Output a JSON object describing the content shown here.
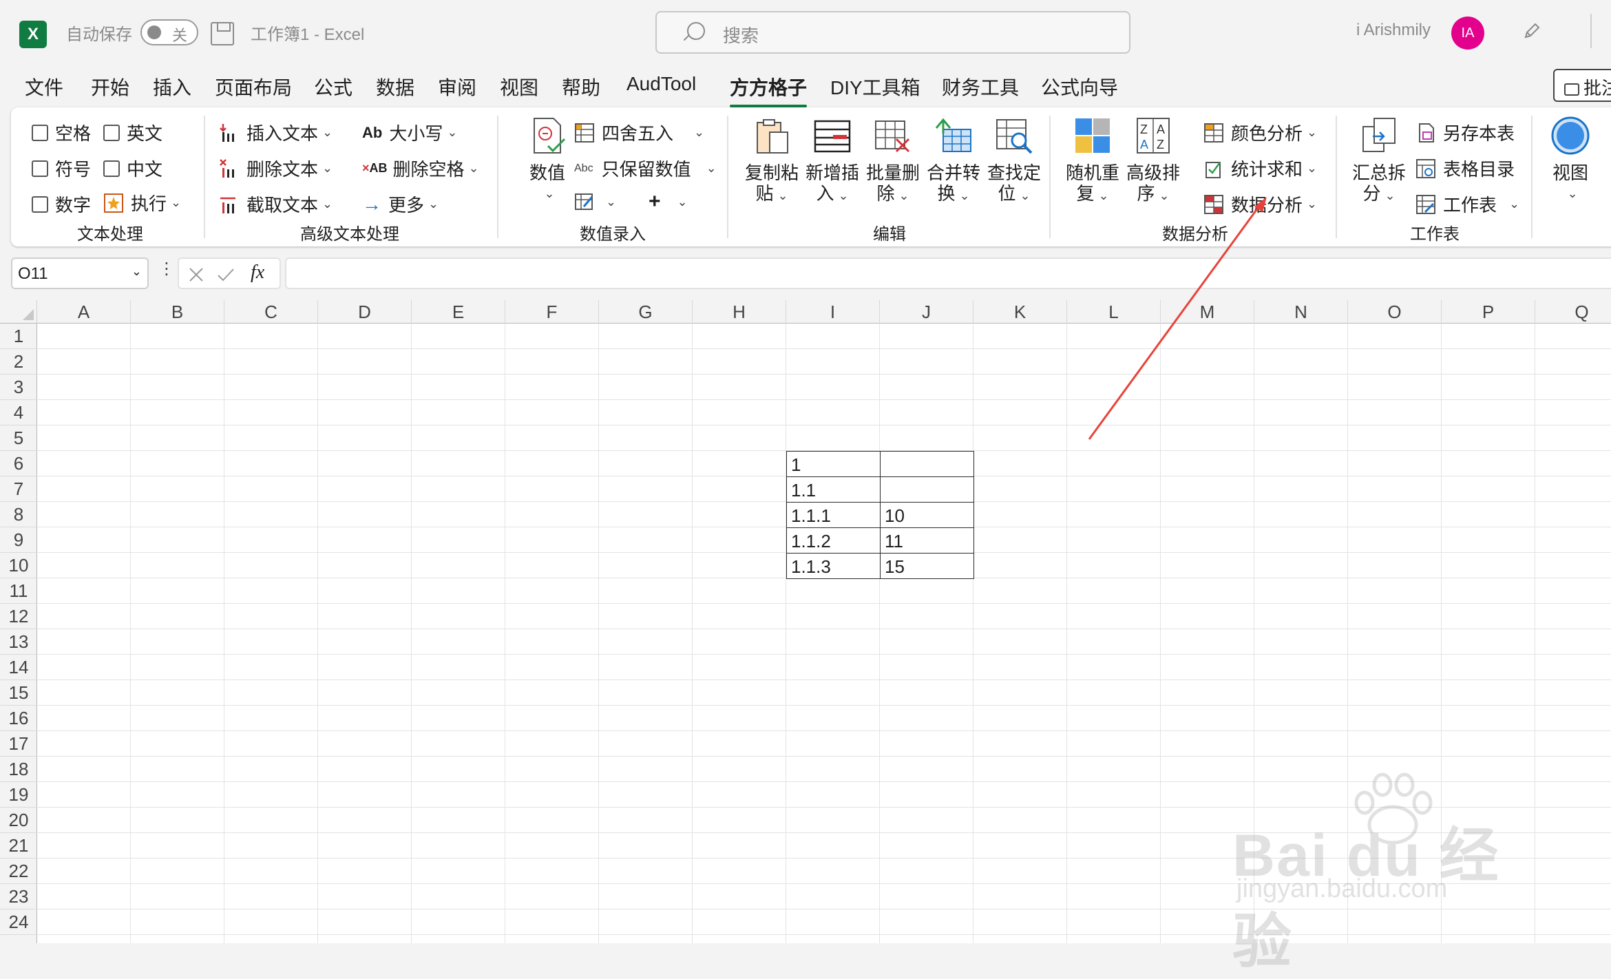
{
  "titlebar": {
    "logo_letter": "X",
    "autosave_label": "自动保存",
    "autosave_state": "关",
    "doc_title": "工作簿1  -  Excel",
    "search_placeholder": "搜索",
    "user_name": "i Arishmily",
    "avatar_initials": "IA"
  },
  "menu": {
    "tabs": [
      "文件",
      "开始",
      "插入",
      "页面布局",
      "公式",
      "数据",
      "审阅",
      "视图",
      "帮助",
      "AudTool",
      "方方格子",
      "DIY工具箱",
      "财务工具",
      "公式向导"
    ],
    "active_tab": "方方格子",
    "comment_button": "批注"
  },
  "ribbon": {
    "text_processing": {
      "label": "文本处理",
      "checkboxes": [
        "空格",
        "英文",
        "符号",
        "中文",
        "数字"
      ],
      "execute": "执行"
    },
    "advanced_text": {
      "label": "高级文本处理",
      "insert_text": "插入文本",
      "delete_text": "删除文本",
      "extract_text": "截取文本",
      "case": "大小写",
      "delete_spaces": "删除空格",
      "more": "更多"
    },
    "number_entry": {
      "label": "数值录入",
      "numeric": "数值",
      "round": "四舍五入",
      "keep_numbers": "只保留数值",
      "abc_icon_text": "Abc"
    },
    "edit": {
      "label": "编辑",
      "copy_paste": [
        "复制粘",
        "贴"
      ],
      "add_insert": [
        "新增插",
        "入"
      ],
      "batch_delete": [
        "批量删",
        "除"
      ],
      "merge_convert": [
        "合并转",
        "换"
      ],
      "find_locate": [
        "查找定",
        "位"
      ]
    },
    "data_analysis": {
      "label": "数据分析",
      "random_repeat": [
        "随机重",
        "复"
      ],
      "advanced_sort": [
        "高级排",
        "序"
      ],
      "color_analysis": "颜色分析",
      "stat_sum": "统计求和",
      "data_analysis_btn": "数据分析"
    },
    "worksheet": {
      "label": "工作表",
      "summarize_split": [
        "汇总拆",
        "分"
      ],
      "save_sheet": "另存本表",
      "table_toc": "表格目录",
      "sheet": "工作表"
    },
    "view": {
      "label": "视图"
    }
  },
  "formula_bar": {
    "name_box": "O11",
    "fx_label": "fx",
    "formula": ""
  },
  "sheet": {
    "columns": [
      "A",
      "B",
      "C",
      "D",
      "E",
      "F",
      "G",
      "H",
      "I",
      "J",
      "K",
      "L",
      "M",
      "N",
      "O",
      "P",
      "Q"
    ],
    "rows": [
      "1",
      "2",
      "3",
      "4",
      "5",
      "6",
      "7",
      "8",
      "9",
      "10",
      "11",
      "12",
      "13",
      "14",
      "15",
      "16",
      "17",
      "18",
      "19",
      "20",
      "21",
      "22",
      "23",
      "24"
    ],
    "table": [
      [
        "1",
        ""
      ],
      [
        "1.1",
        ""
      ],
      [
        "1.1.1",
        "10"
      ],
      [
        "1.1.2",
        "11"
      ],
      [
        "1.1.3",
        "15"
      ]
    ]
  },
  "watermark": {
    "brand": "Bai du 经验",
    "url": "jingyan.baidu.com"
  },
  "colors": {
    "excel_green": "#107c41",
    "avatar_pink": "#e3008c",
    "arrow_red": "#e8433a"
  }
}
